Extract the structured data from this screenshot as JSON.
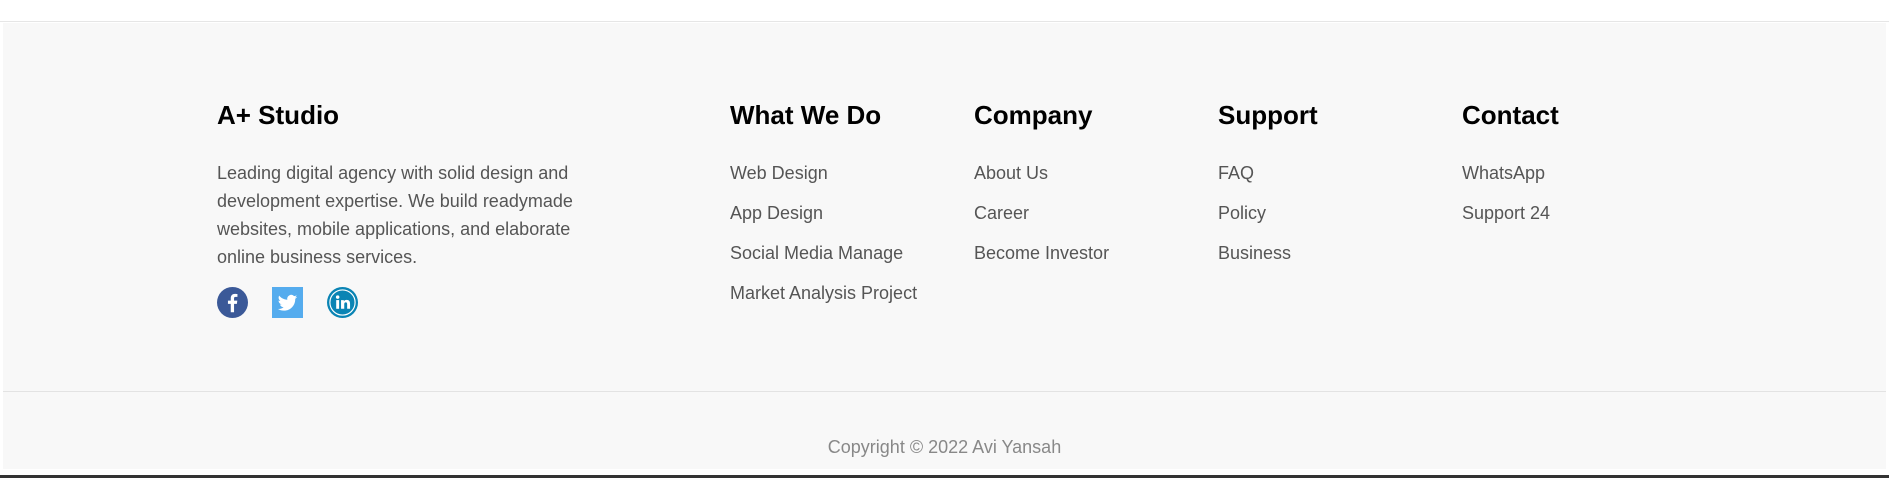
{
  "brand": {
    "name": "A+ Studio",
    "description": "Leading digital agency with solid design and development expertise. We build readymade websites, mobile applications, and elaborate online business services.",
    "socials": [
      {
        "name": "facebook",
        "icon": "facebook-icon",
        "color": "#3b5998"
      },
      {
        "name": "twitter",
        "icon": "twitter-icon",
        "color": "#55acee"
      },
      {
        "name": "linkedin",
        "icon": "linkedin-icon",
        "color": "#0a84b4"
      }
    ]
  },
  "columns": {
    "what_we_do": {
      "title": "What We Do",
      "links": [
        "Web Design",
        "App Design",
        "Social Media Manage",
        "Market Analysis Project"
      ]
    },
    "company": {
      "title": "Company",
      "links": [
        "About Us",
        "Career",
        "Become Investor"
      ]
    },
    "support": {
      "title": "Support",
      "links": [
        "FAQ",
        "Policy",
        "Business"
      ]
    },
    "contact": {
      "title": "Contact",
      "links": [
        "WhatsApp",
        "Support 24"
      ]
    }
  },
  "copyright": "Copyright © 2022 Avi Yansah",
  "colors": {
    "background": "#f8f8f8",
    "heading": "#000000",
    "text": "#555555",
    "muted": "#888888"
  }
}
